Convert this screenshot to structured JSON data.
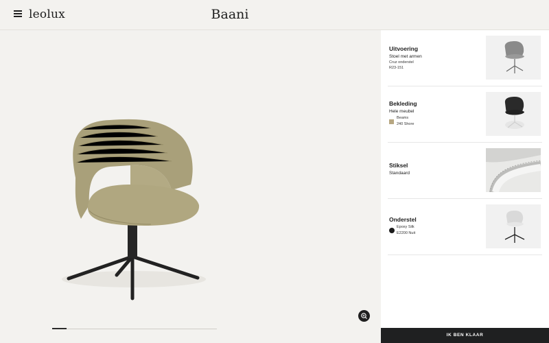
{
  "header": {
    "brand": "leolux",
    "product_title": "Baani"
  },
  "options": [
    {
      "title": "Uitvoering",
      "line1": "Stoel met armen",
      "detail1": "Cruz onderstel",
      "detail2": "R23-151",
      "thumb_icon": "chair-grey-thumbnail"
    },
    {
      "title": "Bekleding",
      "line1": "Hele meubel",
      "detail1": "Beams",
      "detail2": "240 Shore",
      "swatch_color": "#b7a782",
      "thumb_icon": "chair-black-thumbnail"
    },
    {
      "title": "Stiksel",
      "line1": "Standaard",
      "thumb_icon": "stitching-detail-thumbnail"
    },
    {
      "title": "Onderstel",
      "detail1": "Epoxy Silk",
      "detail2": "E2200 Nuit",
      "swatch_color": "#1b1b1b",
      "thumb_icon": "chair-white-thumbnail"
    }
  ],
  "done_label": "IK BEN KLAAR",
  "icons": {
    "menu": "menu-icon",
    "zoom": "zoom-in-icon"
  },
  "colors": {
    "background": "#f3f2ef",
    "panel": "#ffffff",
    "button": "#1f2021",
    "fabric": "#a9a07a"
  }
}
